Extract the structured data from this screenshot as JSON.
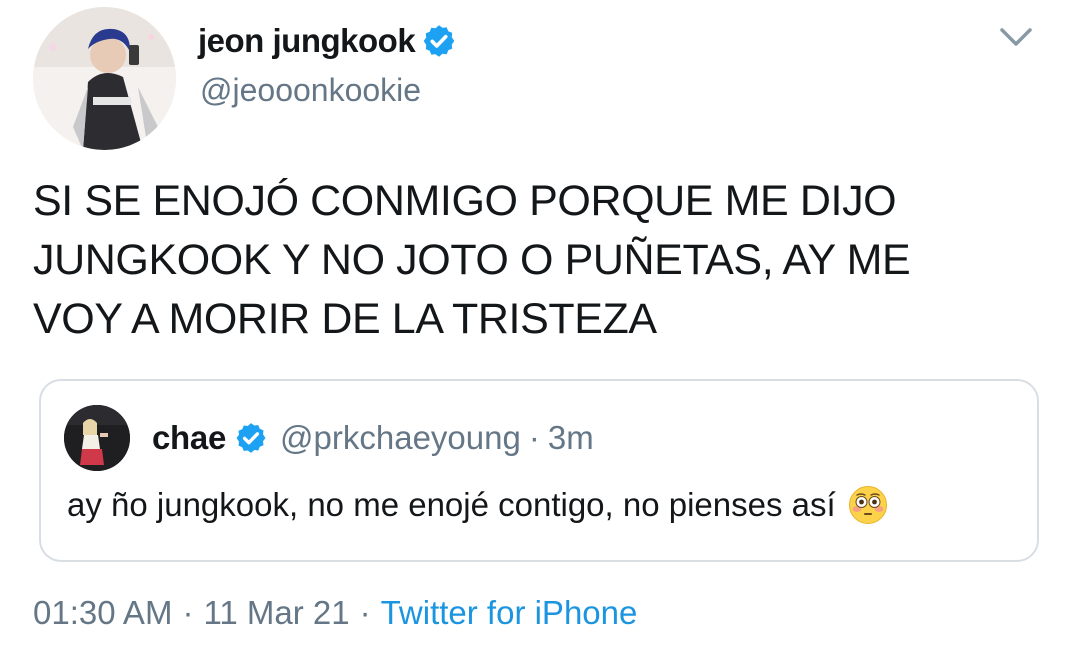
{
  "tweet": {
    "author": {
      "display_name": "jeon jungkook",
      "handle": "@jeooonkookie",
      "verified": true
    },
    "text": "SI SE ENOJÓ CONMIGO PORQUE ME DIJO\nJUNGKOOK Y NO JOTO O PUÑETAS, AY ME\nVOY A MORIR DE LA TRISTEZA",
    "quoted": {
      "display_name": "chae",
      "handle": "@prkchaeyoung",
      "separator": "·",
      "time": "3m",
      "verified": true,
      "text": "ay ño jungkook, no me enojé contigo, no pienses así",
      "emoji": "flushed-face"
    },
    "meta": {
      "time": "01:30 AM",
      "separator_1": "·",
      "date": "11 Mar 21",
      "separator_2": "·",
      "source": "Twitter for iPhone"
    }
  },
  "icons": {
    "verified": "verified-badge-icon",
    "menu": "chevron-down-icon"
  },
  "colors": {
    "text": "#14171a",
    "secondary": "#657786",
    "link": "#1b95e0",
    "verified": "#1da1f2",
    "quote_border": "#d8dee3"
  }
}
